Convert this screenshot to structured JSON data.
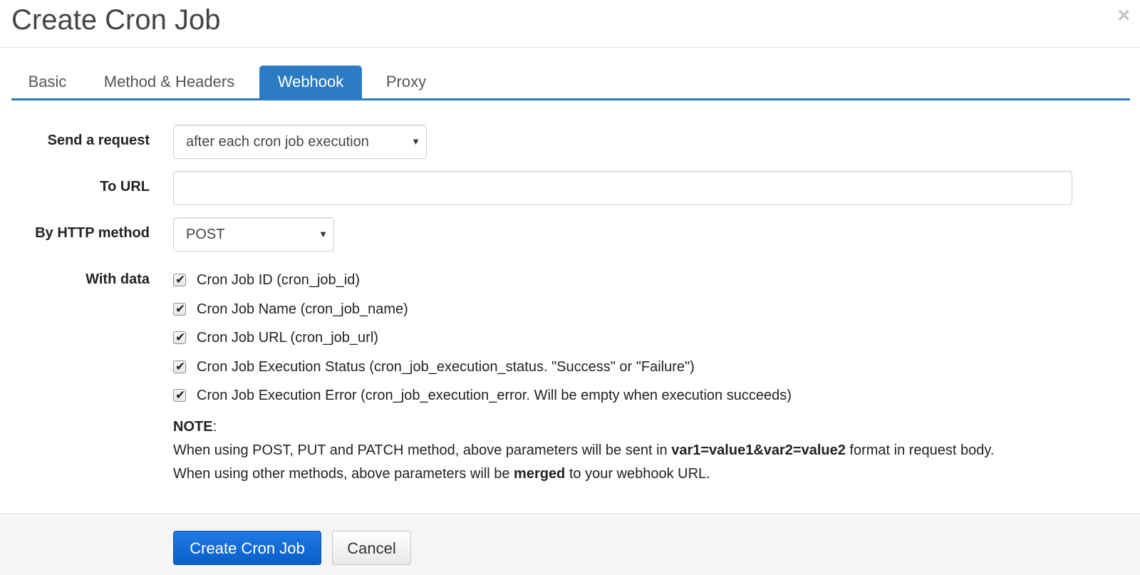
{
  "dialog": {
    "title": "Create Cron Job",
    "close_glyph": "×"
  },
  "tabs": [
    {
      "label": "Basic",
      "active": false
    },
    {
      "label": "Method & Headers",
      "active": false
    },
    {
      "label": "Webhook",
      "active": true
    },
    {
      "label": "Proxy",
      "active": false
    }
  ],
  "form": {
    "send_request": {
      "label": "Send a request",
      "selected": "after each cron job execution"
    },
    "to_url": {
      "label": "To URL",
      "value": ""
    },
    "http_method": {
      "label": "By HTTP method",
      "selected": "POST"
    },
    "with_data": {
      "label": "With data",
      "options": [
        {
          "label": "Cron Job ID (cron_job_id)",
          "checked": true
        },
        {
          "label": "Cron Job Name (cron_job_name)",
          "checked": true
        },
        {
          "label": "Cron Job URL (cron_job_url)",
          "checked": true
        },
        {
          "label": "Cron Job Execution Status (cron_job_execution_status. \"Success\" or \"Failure\")",
          "checked": true
        },
        {
          "label": "Cron Job Execution Error (cron_job_execution_error. Will be empty when execution succeeds)",
          "checked": true
        }
      ]
    },
    "note": {
      "heading": "NOTE",
      "line1_pre": "When using POST, PUT and PATCH method, above parameters will be sent in ",
      "line1_bold": "var1=value1&var2=value2",
      "line1_post": " format in request body.",
      "line2_pre": "When using other methods, above parameters will be ",
      "line2_bold": "merged",
      "line2_post": " to your webhook URL."
    }
  },
  "footer": {
    "create_label": "Create Cron Job",
    "cancel_label": "Cancel"
  },
  "colors": {
    "accent": "#2d7bc4",
    "primary_button": "#0a5ec9"
  }
}
